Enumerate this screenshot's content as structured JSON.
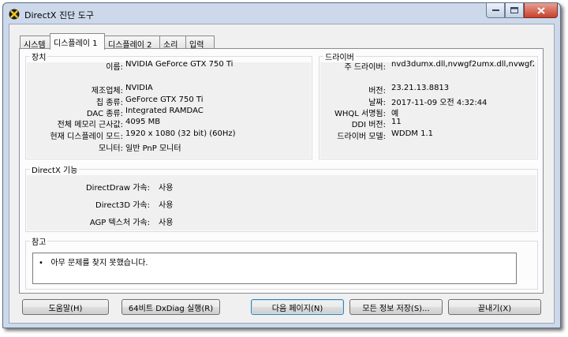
{
  "window": {
    "title": "DirectX 진단 도구",
    "buttons": {
      "minimize": "–",
      "maximize": "□",
      "close": "✕"
    }
  },
  "tabs": [
    {
      "label": "시스템",
      "active": false
    },
    {
      "label": "디스플레이 1",
      "active": true
    },
    {
      "label": "디스플레이 2",
      "active": false
    },
    {
      "label": "소리",
      "active": false
    },
    {
      "label": "입력",
      "active": false
    }
  ],
  "device": {
    "title": "장치",
    "fields": [
      {
        "label": "이름:",
        "value": "NVIDIA GeForce GTX 750 Ti"
      },
      {
        "label": "제조업체:",
        "value": "NVIDIA"
      },
      {
        "label": "칩 종류:",
        "value": "GeForce GTX 750 Ti"
      },
      {
        "label": "DAC 종류:",
        "value": "Integrated RAMDAC"
      },
      {
        "label": "전체 메모리 근사값:",
        "value": "4095 MB"
      },
      {
        "label": "현재 디스플레이 모드:",
        "value": "1920 x 1080 (32 bit) (60Hz)"
      },
      {
        "label": "모니터:",
        "value": "일반 PnP 모니터"
      }
    ]
  },
  "driver": {
    "title": "드라이버",
    "fields": [
      {
        "label": "주 드라이버:",
        "value": "nvd3dumx.dll,nvwgf2umx.dll,nvwgf2u"
      },
      {
        "label": "버전:",
        "value": "23.21.13.8813"
      },
      {
        "label": "날짜:",
        "value": "2017-11-09 오전 4:32:44"
      },
      {
        "label": "WHQL 서명됨:",
        "value": "예"
      },
      {
        "label": "DDI 버전:",
        "value": "11"
      },
      {
        "label": "드라이버 모델:",
        "value": "WDDM 1.1"
      }
    ]
  },
  "features": {
    "title": "DirectX 기능",
    "fields": [
      {
        "label": "DirectDraw 가속:",
        "value": "사용"
      },
      {
        "label": "Direct3D 가속:",
        "value": "사용"
      },
      {
        "label": "AGP 텍스처 가속:",
        "value": "사용"
      }
    ]
  },
  "notes": {
    "title": "참고",
    "items": [
      "아무 문제를 찾지 못했습니다."
    ]
  },
  "buttons": {
    "help": "도움말(H)",
    "dxdiag64": "64비트 DxDiag 실행(R)",
    "next_page": "다음 페이지(N)",
    "save_all": "모든 정보 저장(S)...",
    "exit": "끝내기(X)"
  },
  "colors": {
    "frame": "#cdd9ea",
    "client": "#f0f0f0",
    "panel": "#fcfcfc",
    "close_button": "#c8412b",
    "default_button_border": "#3c7fb1"
  }
}
